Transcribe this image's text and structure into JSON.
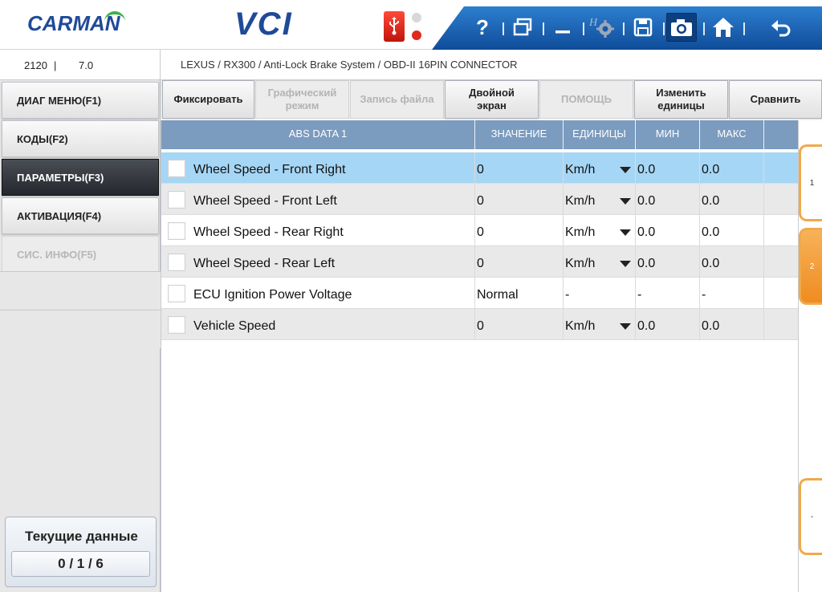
{
  "app": {
    "logo_text": "CARMAN",
    "product_text": "VCI"
  },
  "toolbar": {
    "icons": [
      "help-icon",
      "window-icon",
      "minimize-icon",
      "settings-icon",
      "save-icon",
      "camera-icon",
      "home-icon",
      "back-icon"
    ],
    "help_label": "?"
  },
  "info": {
    "code": "2120",
    "divider": "|",
    "version": "7.0",
    "breadcrumb": "LEXUS / RX300 / Anti-Lock Brake System / OBD-II 16PIN CONNECTOR"
  },
  "sidebar": {
    "items": [
      {
        "label": "ДИАГ МЕНЮ(F1)",
        "state": "normal"
      },
      {
        "label": "КОДЫ(F2)",
        "state": "normal"
      },
      {
        "label": "ПАРАМЕТРЫ(F3)",
        "state": "active"
      },
      {
        "label": "АКТИВАЦИЯ(F4)",
        "state": "normal"
      },
      {
        "label": "СИС. ИНФО(F5)",
        "state": "disabled"
      }
    ],
    "current_data_title": "Текущие данные",
    "current_data_counter": "0 / 1 / 6"
  },
  "functions": {
    "freeze": "Фиксировать",
    "graph_line1": "Графический",
    "graph_line2": "режим",
    "record": "Запись файла",
    "dual_line1": "Двойной",
    "dual_line2": "экран",
    "help": "ПОМОЩЬ",
    "units_line1": "Изменить",
    "units_line2": "единицы",
    "compare": "Сравнить"
  },
  "table": {
    "headers": {
      "name": "ABS DATA 1",
      "value": "ЗНАЧЕНИЕ",
      "units": "ЕДИНИЦЫ",
      "min": "МИН",
      "max": "МАКС"
    },
    "rows": [
      {
        "name": "Wheel Speed - Front Right",
        "value": "0",
        "units": "Km/h",
        "min": "0.0",
        "max": "0.0",
        "has_dropdown": true,
        "selected": true
      },
      {
        "name": "Wheel Speed - Front Left",
        "value": "0",
        "units": "Km/h",
        "min": "0.0",
        "max": "0.0",
        "has_dropdown": true,
        "selected": false
      },
      {
        "name": "Wheel Speed - Rear Right",
        "value": "0",
        "units": "Km/h",
        "min": "0.0",
        "max": "0.0",
        "has_dropdown": true,
        "selected": false
      },
      {
        "name": "Wheel Speed - Rear Left",
        "value": "0",
        "units": "Km/h",
        "min": "0.0",
        "max": "0.0",
        "has_dropdown": true,
        "selected": false
      },
      {
        "name": "ECU Ignition Power Voltage",
        "value": "Normal",
        "units": "-",
        "min": "-",
        "max": "-",
        "has_dropdown": false,
        "selected": false
      },
      {
        "name": "Vehicle Speed",
        "value": "0",
        "units": "Km/h",
        "min": "0.0",
        "max": "0.0",
        "has_dropdown": true,
        "selected": false
      }
    ]
  },
  "pages": {
    "tab1": "1",
    "tab2": "2",
    "tab3": "-"
  },
  "colors": {
    "header_blue": "#1f4a98",
    "table_header": "#7b9bbf",
    "selected_row": "#a6d6f5",
    "page_tab_orange": "#f0a94a"
  }
}
